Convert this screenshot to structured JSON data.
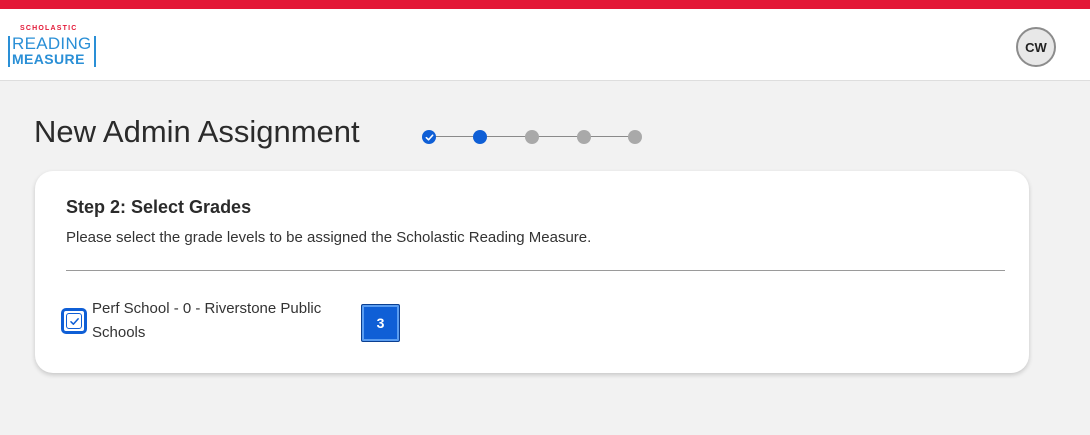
{
  "brand": {
    "publisher": "SCHOLASTIC",
    "product_line1": "READING",
    "product_line2": "MEASURE",
    "accent_color": "#e31837",
    "logo_color": "#2a8fd6"
  },
  "user": {
    "initials": "CW"
  },
  "page": {
    "title": "New Admin Assignment"
  },
  "stepper": {
    "total_steps": 5,
    "current_step": 2,
    "completed_steps": 1,
    "active_color": "#0f5fd6",
    "inactive_color": "#a9a9a9"
  },
  "step": {
    "heading": "Step 2: Select Grades",
    "description": "Please select the grade levels to be assigned the Scholastic Reading Measure."
  },
  "schools": [
    {
      "name": "Perf School - 0 - Riverstone Public Schools",
      "checked": true,
      "grades": [
        "3"
      ]
    }
  ]
}
